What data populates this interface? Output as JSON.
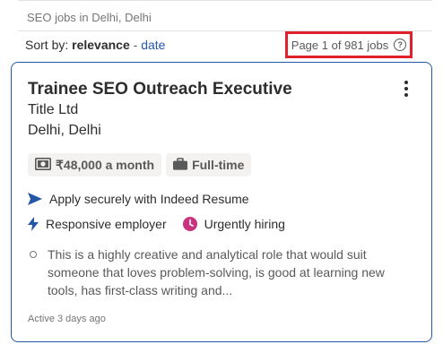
{
  "search": {
    "breadcrumb": "SEO jobs in Delhi, Delhi"
  },
  "sort": {
    "label": "Sort by:",
    "active": "relevance",
    "separator": "-",
    "alternate": "date"
  },
  "pagination": {
    "text": "Page 1 of 981 jobs",
    "help_icon": "question-circle-icon",
    "highlight_color": "#e0202c"
  },
  "job": {
    "title": "Trainee SEO Outreach Executive",
    "company": "Title Ltd",
    "location": "Delhi, Delhi",
    "salary": "₹48,000 a month",
    "job_type": "Full-time",
    "apply_note": "Apply securely with Indeed Resume",
    "employer_badge": "Responsive employer",
    "hiring_badge": "Urgently hiring",
    "snippet": "This is a highly creative and analytical role that would suit someone that loves problem-solving, is good at learning new tools, has first-class writing and...",
    "posted": "Active 3 days ago"
  },
  "colors": {
    "link": "#2557a7",
    "urgent": "#c9337d",
    "card_border": "#2557a7"
  }
}
